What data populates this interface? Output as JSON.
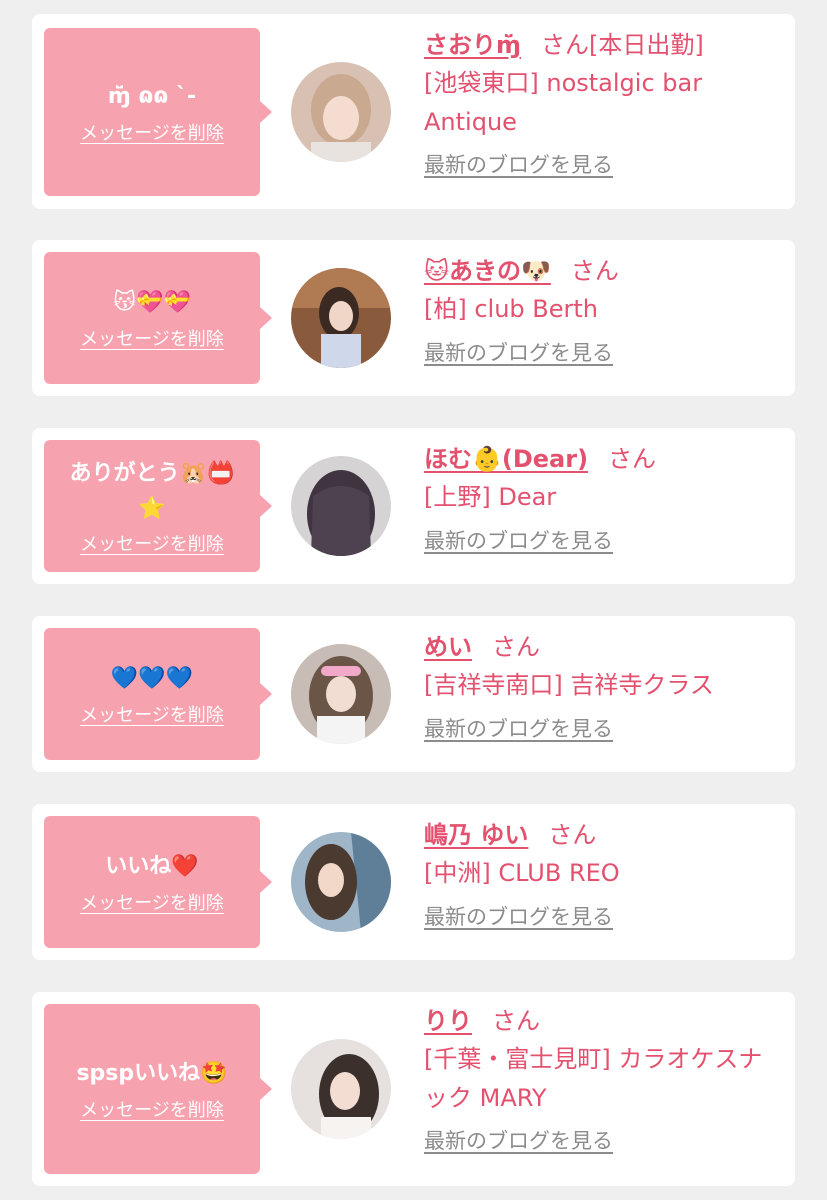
{
  "colors": {
    "background": "#efeff0",
    "card": "#ffffff",
    "bubble": "#f7a2af",
    "accent": "#e3516f",
    "muted": "#8c8c8c"
  },
  "delete_label": "メッセージを削除",
  "blog_label": "最新のブログを見る",
  "honorific": "さん",
  "cards": [
    {
      "message": "ɱ̆̈ ɷɷ ˋ-",
      "name": "さおりɱ̆̈",
      "status": "[本日出勤]",
      "shop": "[池袋東口] nostalgic bar Antique"
    },
    {
      "message": "😽💝💝",
      "name": "🐱あきの🐶",
      "status": "",
      "shop": "[柏] club Berth"
    },
    {
      "message": "ありがとう🐹📛⭐",
      "name": "ほむ👶(Dear)",
      "status": "",
      "shop": "[上野] Dear"
    },
    {
      "message": "💙💙💙",
      "name": "めい",
      "status": "",
      "shop": "[吉祥寺南口] 吉祥寺クラス"
    },
    {
      "message": "いいね❤️",
      "name": "嶋乃 ゆい",
      "status": "",
      "shop": "[中洲] CLUB REO"
    },
    {
      "message": "spspいいね🤩",
      "name": "りり",
      "status": "",
      "shop": "[千葉・富士見町] カラオケスナック MARY"
    }
  ]
}
